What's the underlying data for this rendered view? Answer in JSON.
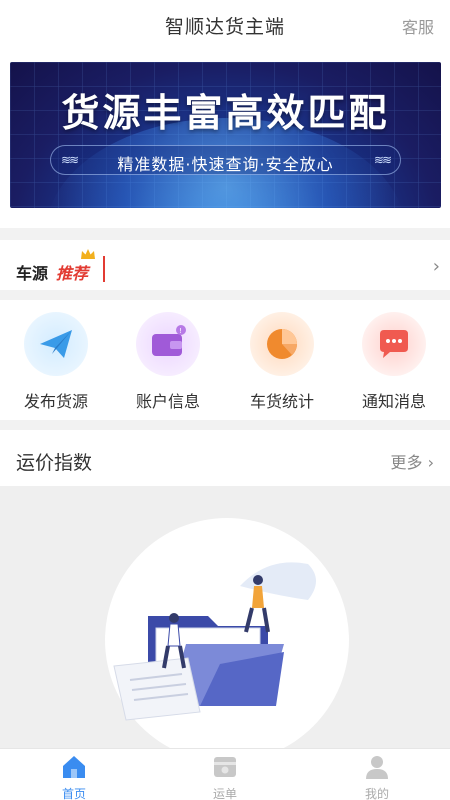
{
  "header": {
    "title": "智顺达货主端",
    "service_label": "客服"
  },
  "banner": {
    "headline": "货源丰富高效匹配",
    "tagline": "精准数据·快速查询·安全放心"
  },
  "recommend": {
    "label_a": "车源",
    "label_b": "推荐",
    "chevron": "›"
  },
  "quick_actions": [
    {
      "label": "发布货源",
      "icon": "paper-plane-icon",
      "color": "#3a9be8"
    },
    {
      "label": "账户信息",
      "icon": "wallet-icon",
      "color": "#a05ad8"
    },
    {
      "label": "车货统计",
      "icon": "pie-chart-icon",
      "color": "#f08a2e"
    },
    {
      "label": "通知消息",
      "icon": "chat-bubble-icon",
      "color": "#f05a50"
    }
  ],
  "freight_index": {
    "title": "运价指数",
    "more_label": "更多 ›"
  },
  "tabbar": [
    {
      "label": "首页",
      "icon": "home-icon",
      "active": true
    },
    {
      "label": "运单",
      "icon": "waybill-icon",
      "active": false
    },
    {
      "label": "我的",
      "icon": "user-icon",
      "active": false
    }
  ],
  "colors": {
    "accent": "#3a8cf0",
    "highlight_red": "#e23b32",
    "background_gray": "#f2f2f2"
  }
}
